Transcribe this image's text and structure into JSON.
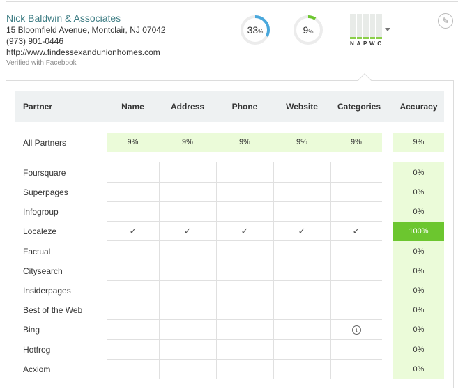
{
  "business": {
    "name": "Nick Baldwin & Associates",
    "address": "15 Bloomfield Avenue, Montclair, NJ 07042",
    "phone": "(973) 901-0446",
    "website": "http://www.findessexandunionhomes.com",
    "verified": "Verified with Facebook"
  },
  "scores": [
    {
      "value": "33",
      "unit": "%",
      "fraction": 0.33,
      "color": "#4aa8dc"
    },
    {
      "value": "9",
      "unit": "%",
      "fraction": 0.09,
      "color": "#6cc62f"
    }
  ],
  "napwc": {
    "letters": [
      "N",
      "A",
      "P",
      "W",
      "C"
    ],
    "icon": "bar-chart-icon",
    "dropdown_icon": "chevron-down-icon"
  },
  "edit_icon": "pencil-icon",
  "table": {
    "headers": [
      "Partner",
      "Name",
      "Address",
      "Phone",
      "Website",
      "Categories",
      "Accuracy"
    ],
    "all_partners": {
      "label": "All Partners",
      "values": [
        "9%",
        "9%",
        "9%",
        "9%",
        "9%"
      ],
      "accuracy": "9%"
    },
    "rows": [
      {
        "partner": "Foursquare",
        "accuracy": "0%"
      },
      {
        "partner": "Superpages",
        "accuracy": "0%"
      },
      {
        "partner": "Infogroup",
        "accuracy": "0%"
      },
      {
        "partner": "Localeze",
        "accuracy": "100%",
        "checks": [
          "✓",
          "✓",
          "✓",
          "✓",
          "✓"
        ]
      },
      {
        "partner": "Factual",
        "accuracy": "0%"
      },
      {
        "partner": "Citysearch",
        "accuracy": "0%"
      },
      {
        "partner": "Insiderpages",
        "accuracy": "0%"
      },
      {
        "partner": "Best of the Web",
        "accuracy": "0%"
      },
      {
        "partner": "Bing",
        "accuracy": "0%",
        "info_icon": "info-icon"
      },
      {
        "partner": "Hotfrog",
        "accuracy": "0%"
      },
      {
        "partner": "Acxiom",
        "accuracy": "0%"
      }
    ]
  },
  "colors": {
    "accent_blue": "#4aa8dc",
    "accent_green": "#6cc62f",
    "light_green": "#ebfbd9",
    "header_bg": "#eef1f2"
  }
}
